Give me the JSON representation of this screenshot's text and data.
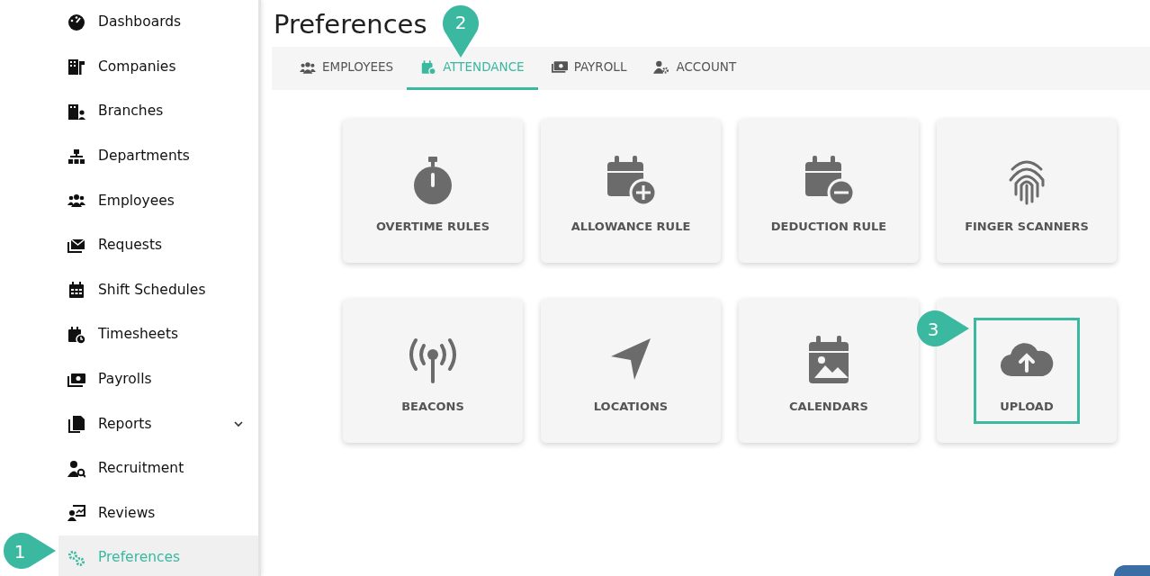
{
  "sidebar": {
    "items": [
      {
        "label": "Dashboards",
        "selected": false
      },
      {
        "label": "Companies",
        "selected": false
      },
      {
        "label": "Branches",
        "selected": false
      },
      {
        "label": "Departments",
        "selected": false
      },
      {
        "label": "Employees",
        "selected": false
      },
      {
        "label": "Requests",
        "selected": false
      },
      {
        "label": "Shift Schedules",
        "selected": false
      },
      {
        "label": "Timesheets",
        "selected": false
      },
      {
        "label": "Payrolls",
        "selected": false
      },
      {
        "label": "Reports",
        "selected": false,
        "expanded": false
      },
      {
        "label": "Recruitment",
        "selected": false
      },
      {
        "label": "Reviews",
        "selected": false
      },
      {
        "label": "Preferences",
        "selected": true
      }
    ]
  },
  "page": {
    "title": "Preferences"
  },
  "tabs": [
    {
      "label": "EMPLOYEES",
      "selected": false
    },
    {
      "label": "ATTENDANCE",
      "selected": true
    },
    {
      "label": "PAYROLL",
      "selected": false
    },
    {
      "label": "ACCOUNT",
      "selected": false
    }
  ],
  "tiles": [
    {
      "label": "OVERTIME RULES",
      "highlighted": false
    },
    {
      "label": "ALLOWANCE RULE",
      "highlighted": false
    },
    {
      "label": "DEDUCTION RULE",
      "highlighted": false
    },
    {
      "label": "FINGER SCANNERS",
      "highlighted": false
    },
    {
      "label": "BEACONS",
      "highlighted": false
    },
    {
      "label": "LOCATIONS",
      "highlighted": false
    },
    {
      "label": "CALENDARS",
      "highlighted": false
    },
    {
      "label": "UPLOAD",
      "highlighted": true
    }
  ],
  "callouts": [
    {
      "label": "1"
    },
    {
      "label": "2"
    },
    {
      "label": "3"
    }
  ]
}
